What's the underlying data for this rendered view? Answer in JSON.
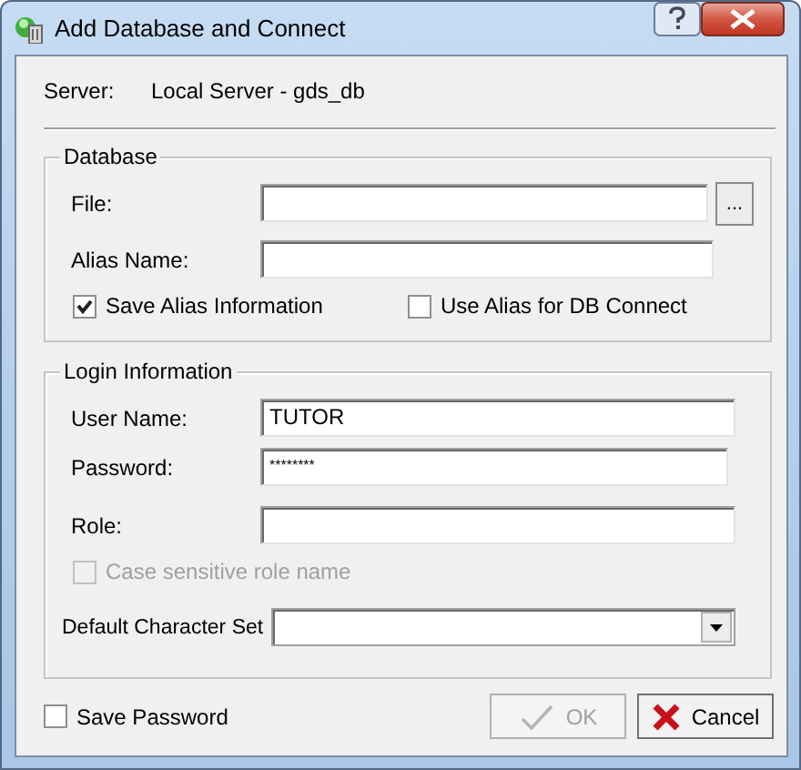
{
  "window": {
    "title": "Add Database and Connect"
  },
  "server": {
    "label": "Server:",
    "value": "Local Server - gds_db"
  },
  "database": {
    "title": "Database",
    "fields": [
      {
        "kind": "file",
        "label": "File:",
        "browse": "..."
      },
      {
        "kind": "text",
        "label": "Alias Name:"
      }
    ],
    "checkboxes": [
      {
        "label": "Save Alias Information",
        "checked": true
      },
      {
        "label": "Use Alias for DB Connect",
        "checked": false
      }
    ]
  },
  "login": {
    "title": "Login Information",
    "fields": [
      {
        "kind": "text",
        "label": "User Name:",
        "value": "TUTOR"
      },
      {
        "kind": "password",
        "label": "Password:",
        "value": "********"
      },
      {
        "kind": "text",
        "label": "Role:"
      }
    ],
    "case_sensitive": {
      "label": "Case sensitive role name",
      "checked": false,
      "disabled": true
    },
    "charset": {
      "label": "Default Character  Set"
    }
  },
  "save_password": {
    "label": "Save Password",
    "checked": false
  },
  "buttons": [
    {
      "kind": "ok",
      "label": "OK",
      "disabled": true
    },
    {
      "kind": "cancel",
      "label": "Cancel",
      "disabled": false
    }
  ]
}
